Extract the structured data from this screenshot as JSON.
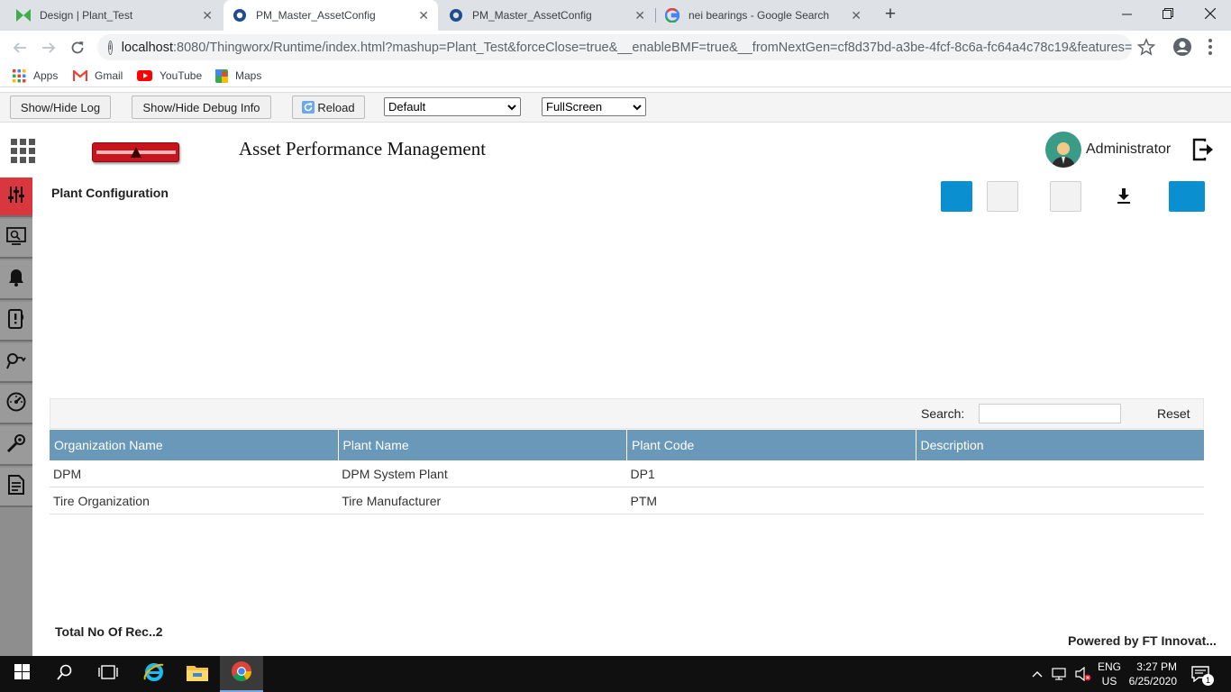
{
  "browser": {
    "tabs": [
      {
        "label": "Design | Plant_Test",
        "active": false
      },
      {
        "label": "PM_Master_AssetConfig",
        "active": true
      },
      {
        "label": "PM_Master_AssetConfig",
        "active": false
      },
      {
        "label": "nei bearings - Google Search",
        "active": false
      }
    ],
    "new_tab": "+",
    "url_host": "localhost",
    "url_rest": ":8080/Thingworx/Runtime/index.html?mashup=Plant_Test&forceClose=true&__enableBMF=true&__fromNextGen=cf8d37bd-a3be-4fcf-8c6a-fc64a4c78c19&features=#...",
    "bookmarks": [
      "Apps",
      "Gmail",
      "YouTube",
      "Maps"
    ]
  },
  "debug": {
    "show_hide_log": "Show/Hide Log",
    "show_hide_debug": "Show/Hide Debug Info",
    "reload": "Reload",
    "theme_select": "Default",
    "mode_select": "FullScreen"
  },
  "app": {
    "title": "Asset Performance Management",
    "user": "Administrator",
    "page_title": "Plant Configuration"
  },
  "toolbar_colors": {
    "primary": "#0a8fd0",
    "light": "#f2f2f2"
  },
  "search": {
    "label": "Search:",
    "value": "",
    "reset": "Reset"
  },
  "grid": {
    "columns": [
      "Organization Name",
      "Plant Name",
      "Plant Code",
      "Description"
    ],
    "rows": [
      [
        "DPM",
        "DPM System Plant",
        "DP1",
        ""
      ],
      [
        "Tire Organization",
        "Tire Manufacturer",
        "PTM",
        ""
      ]
    ]
  },
  "footer": {
    "total": "Total No Of Rec..2",
    "powered": "Powered by FT Innovat..."
  },
  "system": {
    "lang": "ENG",
    "region": "US",
    "time": "3:27 PM",
    "date": "6/25/2020",
    "notif_count": "1"
  }
}
